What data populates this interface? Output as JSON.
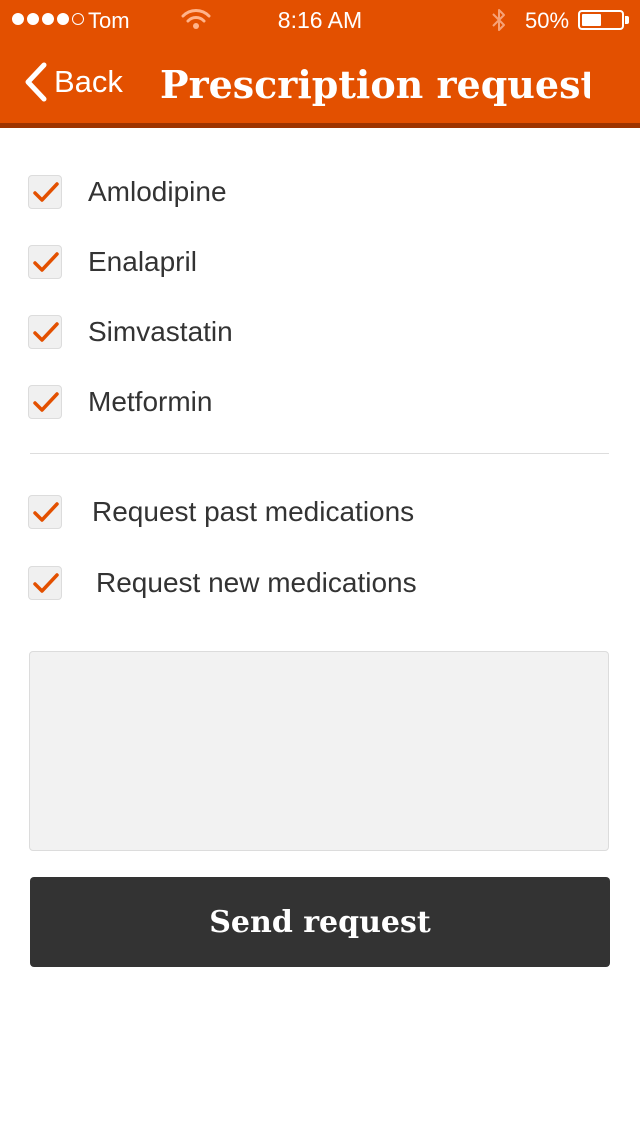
{
  "status_bar": {
    "carrier": "Tom",
    "time": "8:16 AM",
    "battery_percent": "50%",
    "battery_level": 0.5,
    "signal_filled": 4,
    "signal_total": 5,
    "icons": [
      "signal-dots",
      "wifi-icon",
      "bluetooth-icon",
      "battery-icon"
    ]
  },
  "nav": {
    "back_label": "Back",
    "title": "Prescription request..."
  },
  "medications": [
    {
      "label": "Amlodipine",
      "checked": true
    },
    {
      "label": "Enalapril",
      "checked": true
    },
    {
      "label": "Simvastatin",
      "checked": true
    },
    {
      "label": "Metformin",
      "checked": true
    }
  ],
  "options": [
    {
      "label": "Request past medications",
      "checked": true
    },
    {
      "label": "Request new medications",
      "checked": true
    }
  ],
  "notes": {
    "value": "",
    "placeholder": ""
  },
  "send_button_label": "Send request",
  "colors": {
    "accent": "#e35000",
    "accent_dark": "#9e3400",
    "button": "#333333",
    "checkmark": "#e35000"
  }
}
